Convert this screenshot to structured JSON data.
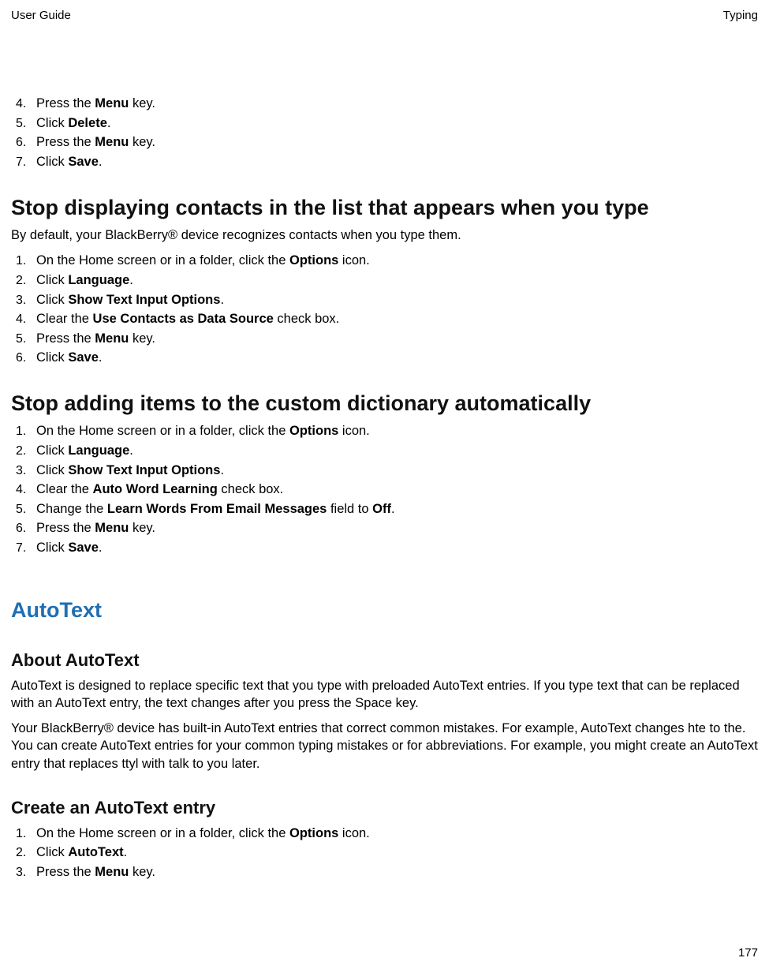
{
  "header": {
    "left": "User Guide",
    "right": "Typing"
  },
  "pageNum": "177",
  "intro_list": {
    "start": 4,
    "items": [
      [
        {
          "t": "Press the "
        },
        {
          "b": "Menu"
        },
        {
          "t": " key."
        }
      ],
      [
        {
          "t": "Click "
        },
        {
          "b": "Delete"
        },
        {
          "t": "."
        }
      ],
      [
        {
          "t": "Press the "
        },
        {
          "b": "Menu"
        },
        {
          "t": " key."
        }
      ],
      [
        {
          "t": "Click "
        },
        {
          "b": "Save"
        },
        {
          "t": "."
        }
      ]
    ]
  },
  "s1": {
    "title": "Stop displaying contacts in the list that appears when you type",
    "para": "By default, your BlackBerry® device recognizes contacts when you type them.",
    "items": [
      [
        {
          "t": "On the Home screen or in a folder, click the "
        },
        {
          "b": "Options"
        },
        {
          "t": " icon."
        }
      ],
      [
        {
          "t": "Click "
        },
        {
          "b": "Language"
        },
        {
          "t": "."
        }
      ],
      [
        {
          "t": "Click "
        },
        {
          "b": "Show Text Input Options"
        },
        {
          "t": "."
        }
      ],
      [
        {
          "t": "Clear the "
        },
        {
          "b": "Use Contacts as Data Source"
        },
        {
          "t": " check box."
        }
      ],
      [
        {
          "t": "Press the "
        },
        {
          "b": "Menu"
        },
        {
          "t": " key."
        }
      ],
      [
        {
          "t": "Click "
        },
        {
          "b": "Save"
        },
        {
          "t": "."
        }
      ]
    ]
  },
  "s2": {
    "title": "Stop adding items to the custom dictionary automatically",
    "items": [
      [
        {
          "t": "On the Home screen or in a folder, click the "
        },
        {
          "b": "Options"
        },
        {
          "t": " icon."
        }
      ],
      [
        {
          "t": "Click "
        },
        {
          "b": "Language"
        },
        {
          "t": "."
        }
      ],
      [
        {
          "t": "Click "
        },
        {
          "b": "Show Text Input Options"
        },
        {
          "t": "."
        }
      ],
      [
        {
          "t": "Clear the "
        },
        {
          "b": "Auto Word Learning"
        },
        {
          "t": " check box."
        }
      ],
      [
        {
          "t": "Change the "
        },
        {
          "b": "Learn Words From Email Messages"
        },
        {
          "t": " field to "
        },
        {
          "b": "Off"
        },
        {
          "t": "."
        }
      ],
      [
        {
          "t": "Press the "
        },
        {
          "b": "Menu"
        },
        {
          "t": " key."
        }
      ],
      [
        {
          "t": "Click "
        },
        {
          "b": "Save"
        },
        {
          "t": "."
        }
      ]
    ]
  },
  "autotext": {
    "title": "AutoText",
    "about_title": "About AutoText",
    "about_p1": "AutoText is designed to replace specific text that you type with preloaded AutoText entries. If you type text that can be replaced with an AutoText entry, the text changes after you press the Space key.",
    "about_p2": "Your BlackBerry® device has built-in AutoText entries that correct common mistakes. For example, AutoText changes hte to the. You can create AutoText entries for your common typing mistakes or for abbreviations. For example, you might create an AutoText entry that replaces ttyl with talk to you later.",
    "create_title": "Create an AutoText entry",
    "create_items": [
      [
        {
          "t": "On the Home screen or in a folder, click the "
        },
        {
          "b": "Options"
        },
        {
          "t": " icon."
        }
      ],
      [
        {
          "t": "Click "
        },
        {
          "b": "AutoText"
        },
        {
          "t": "."
        }
      ],
      [
        {
          "t": "Press the "
        },
        {
          "b": "Menu"
        },
        {
          "t": " key."
        }
      ]
    ]
  }
}
